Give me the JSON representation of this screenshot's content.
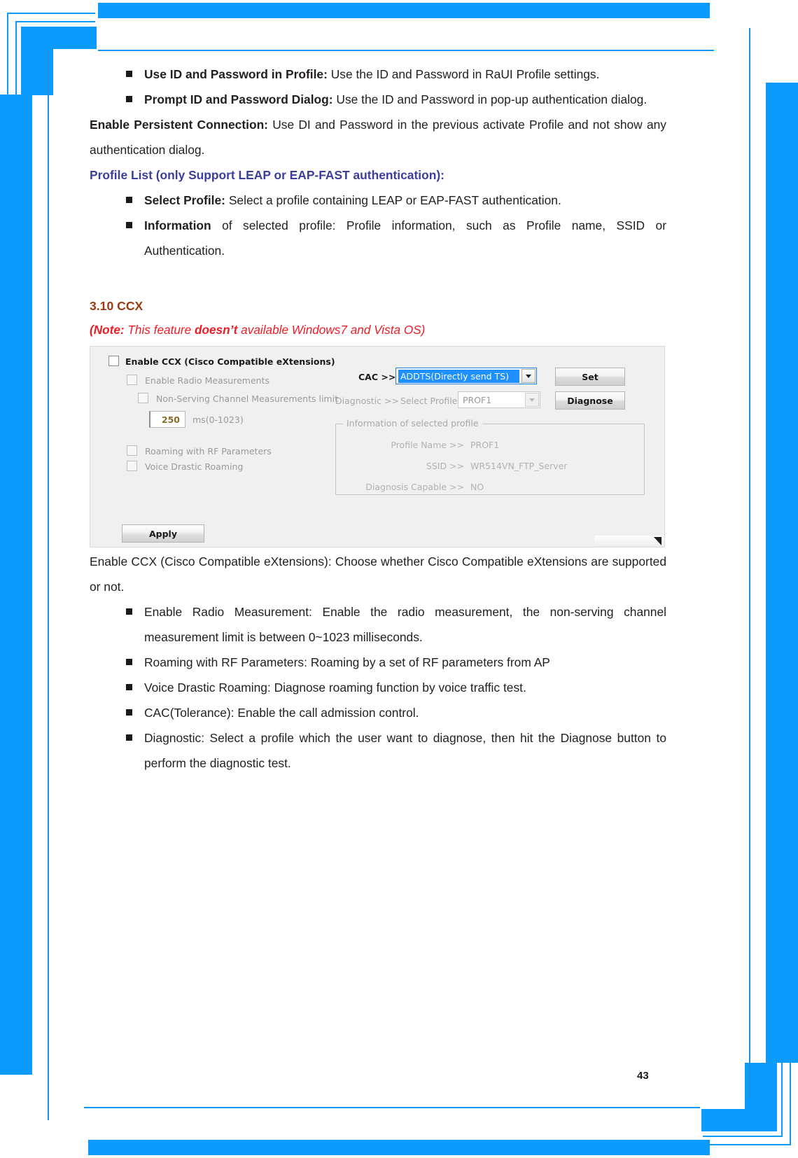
{
  "page": {
    "number": "43",
    "accent_blue": "#0c9bfd",
    "heading_color": "#9c3a10",
    "subhead_color": "#3b3f9c",
    "note_color": "#ee1c25"
  },
  "body": {
    "bullets_top": [
      {
        "bold": "Use ID and Password in Profile:",
        "rest": " Use the ID and Password in RaUI Profile settings."
      },
      {
        "bold": "Prompt ID and Password Dialog:",
        "rest": " Use the ID and Password in pop-up authentication dialog."
      }
    ],
    "persistent_paragraph": {
      "bold": "Enable Persistent Connection:",
      "rest": " Use DI and Password in the previous activate Profile and not show any authentication dialog."
    },
    "profile_list_heading": "Profile List (only Support LEAP or EAP-FAST authentication):",
    "bullets_profile": [
      {
        "bold": "Select Profile:",
        "rest": " Select a profile containing LEAP or EAP-FAST authentication."
      },
      {
        "bold": "Information",
        "rest": " of selected profile: Profile information, such as Profile name, SSID or Authentication."
      }
    ],
    "section_heading": "3.10 CCX",
    "note": {
      "lead": "(Note:",
      "mid": " This feature ",
      "emph": "doesn’t",
      "tail": " available Windows7 and Vista OS)"
    },
    "enable_ccx_paragraph": "Enable CCX (Cisco Compatible eXtensions): Choose whether Cisco Compatible eXtensions are supported or not.",
    "bullets_bottom": [
      "Enable Radio Measurement: Enable the radio measurement, the non-serving channel measurement limit is between 0~1023 milliseconds.",
      "Roaming with RF Parameters: Roaming by a set of RF parameters from AP",
      "Voice Drastic Roaming: Diagnose roaming function by voice traffic test.",
      "CAC(Tolerance): Enable the call admission control.",
      "Diagnostic: Select a profile which the user want to diagnose, then hit the Diagnose button to perform the diagnostic test."
    ]
  },
  "ccx_dialog": {
    "checkboxes": {
      "enable_ccx": "Enable CCX (Cisco Compatible eXtensions)",
      "enable_radio_measurements": "Enable Radio Measurements",
      "non_serving_channel_limit": "Non-Serving Channel Measurements limit",
      "roaming_with_rf": "Roaming with RF Parameters",
      "voice_drastic_roaming": "Voice Drastic Roaming"
    },
    "spinner": {
      "value": "250",
      "units_label": "ms(0-1023)"
    },
    "cac": {
      "label": "CAC >>",
      "selected": "ADDTS(Directly send TS)"
    },
    "diagnostic": {
      "label": "Diagnostic >>",
      "select_profile_label": "Select Profile",
      "selected_profile": "PROF1"
    },
    "buttons": {
      "set": "Set",
      "diagnose": "Diagnose",
      "apply": "Apply"
    },
    "info_group": {
      "title": "Information of selected profile",
      "rows": [
        {
          "label": "Profile Name >>",
          "value": "PROF1"
        },
        {
          "label": "SSID >>",
          "value": "WR514VN_FTP_Server"
        },
        {
          "label": "Diagnosis Capable >>",
          "value": "NO"
        }
      ]
    }
  }
}
